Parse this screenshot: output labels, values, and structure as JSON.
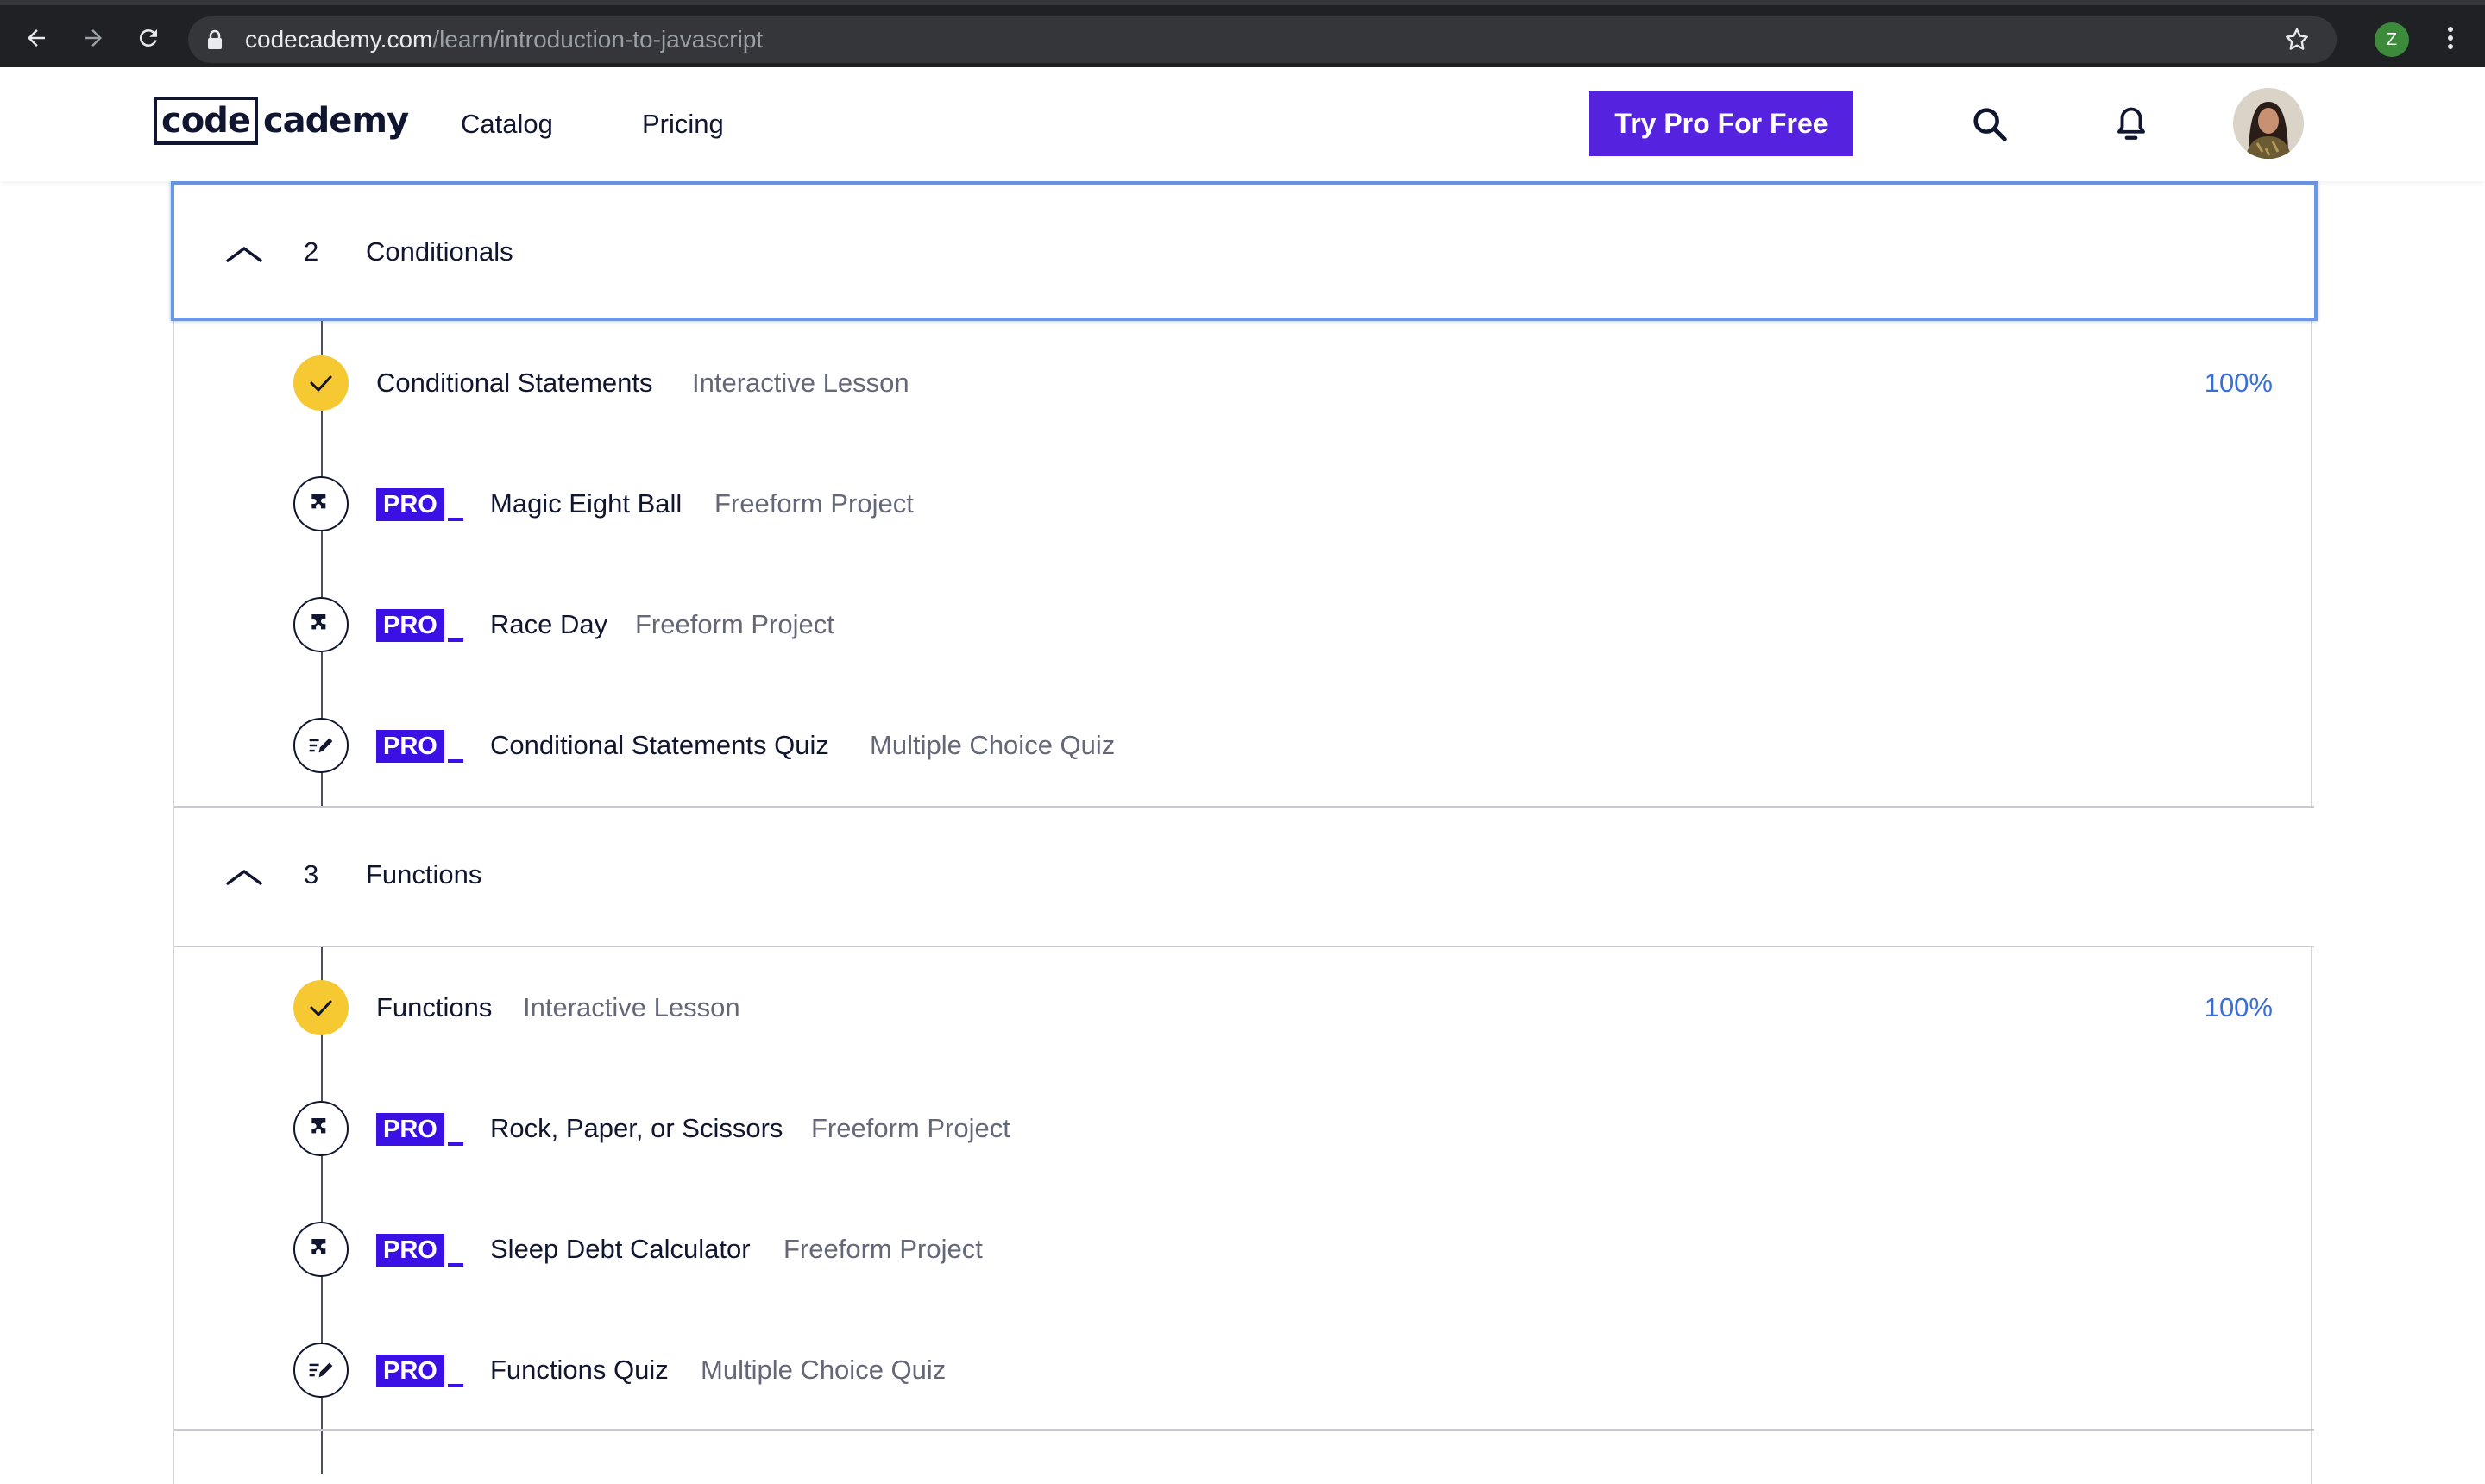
{
  "browser": {
    "url_host": "codecademy.com",
    "url_path": "/learn/introduction-to-javascript",
    "profile_initial": "Z",
    "icons": [
      "back-arrow-icon",
      "forward-arrow-icon",
      "reload-icon",
      "lock-icon",
      "star-icon",
      "kebab-menu-icon"
    ]
  },
  "header": {
    "logo_boxed": "code",
    "logo_rest": "cademy",
    "nav": [
      "Catalog",
      "Pricing"
    ],
    "cta": "Try Pro For Free",
    "icons": [
      "search-icon",
      "bell-icon"
    ],
    "brand_color": "#5523e0"
  },
  "modules": [
    {
      "number": "2",
      "title": "Conditionals",
      "expanded": true,
      "items": [
        {
          "name": "Conditional Statements",
          "type": "Interactive Lesson",
          "pro": false,
          "icon": "check-icon",
          "progress": "100%"
        },
        {
          "name": "Magic Eight Ball",
          "type": "Freeform Project",
          "pro": true,
          "pro_label": "PRO",
          "icon": "puzzle-icon"
        },
        {
          "name": "Race Day",
          "type": "Freeform Project",
          "pro": true,
          "pro_label": "PRO",
          "icon": "puzzle-icon"
        },
        {
          "name": "Conditional Statements Quiz",
          "type": "Multiple Choice Quiz",
          "pro": true,
          "pro_label": "PRO",
          "icon": "quiz-pencil-icon"
        }
      ]
    },
    {
      "number": "3",
      "title": "Functions",
      "expanded": true,
      "items": [
        {
          "name": "Functions",
          "type": "Interactive Lesson",
          "pro": false,
          "icon": "check-icon",
          "progress": "100%"
        },
        {
          "name": "Rock, Paper, or Scissors",
          "type": "Freeform Project",
          "pro": true,
          "pro_label": "PRO",
          "icon": "puzzle-icon"
        },
        {
          "name": "Sleep Debt Calculator",
          "type": "Freeform Project",
          "pro": true,
          "pro_label": "PRO",
          "icon": "puzzle-icon"
        },
        {
          "name": "Functions Quiz",
          "type": "Multiple Choice Quiz",
          "pro": true,
          "pro_label": "PRO",
          "icon": "quiz-pencil-icon"
        }
      ]
    }
  ],
  "colors": {
    "pro_tag": "#3a10e5",
    "complete_node": "#f6c832",
    "progress_text": "#3a6fd8",
    "focus_ring": "#6a98e8"
  }
}
